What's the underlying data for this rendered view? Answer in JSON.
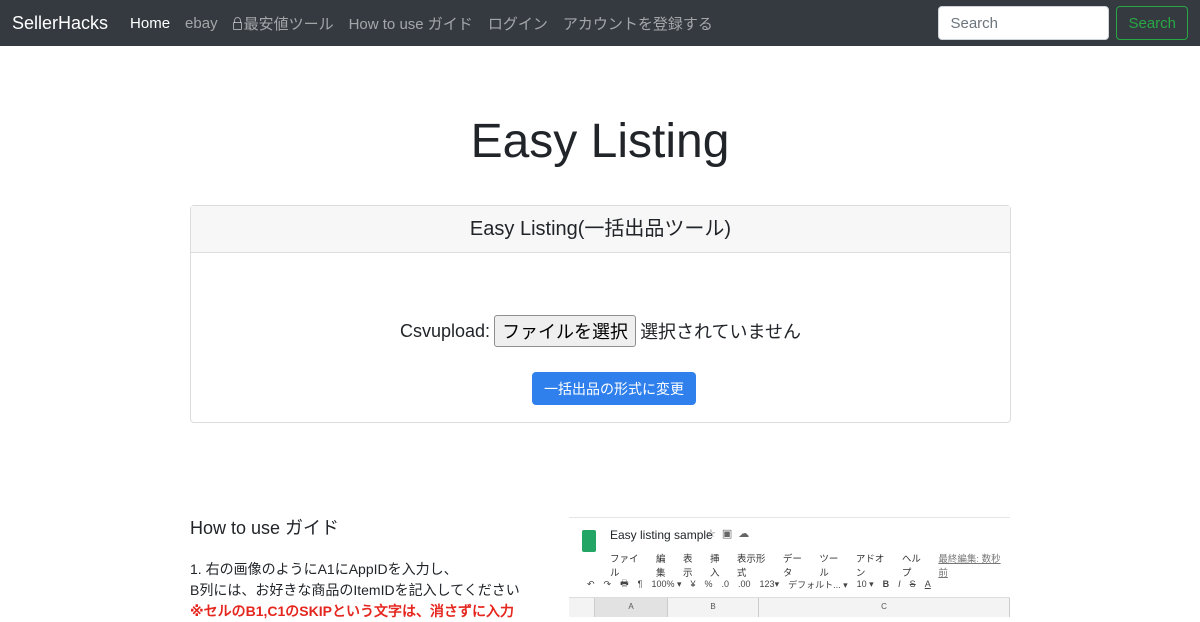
{
  "nav": {
    "brand": "SellerHacks",
    "items": [
      "Home",
      "ebay",
      "最安値ツール",
      "How to use ガイド",
      "ログイン",
      "アカウントを登録する"
    ],
    "search_placeholder": "Search",
    "search_button": "Search"
  },
  "page_title": "Easy Listing",
  "card": {
    "header": "Easy Listing(一括出品ツール)",
    "upload_label": "Csvupload:",
    "file_button": "ファイルを選択",
    "file_status": "選択されていません",
    "convert_button": "一括出品の形式に変更"
  },
  "guide": {
    "title": "How to use ガイド",
    "line1": "1. 右の画像のようにA1にAppIDを入力し、",
    "line2": "B列には、お好きな商品のItemIDを記入してください",
    "warning": "※セルのB1,C1のSKIPという文字は、消さずに入力"
  },
  "sheet": {
    "title": "Easy listing sample",
    "icons": [
      "star-icon",
      "folder-icon",
      "cloud-icon"
    ],
    "menu": [
      "ファイル",
      "編集",
      "表示",
      "挿入",
      "表示形式",
      "データ",
      "ツール",
      "アドオン",
      "ヘルプ"
    ],
    "last_edit": "最終編集: 数秒前",
    "toolbar": [
      "↶",
      "↷",
      "🖶",
      "¶",
      "100% ▾",
      "¥",
      "%",
      ".0",
      ".00",
      "123▾",
      "デフォルト... ▾",
      "10 ▾",
      "B",
      "I",
      "S",
      "A"
    ],
    "columns": [
      "A",
      "B",
      "C"
    ]
  },
  "colors": {
    "navbar": "#343a40",
    "primary": "#2f80ed",
    "success": "#28a745",
    "warning": "#e5261e"
  }
}
